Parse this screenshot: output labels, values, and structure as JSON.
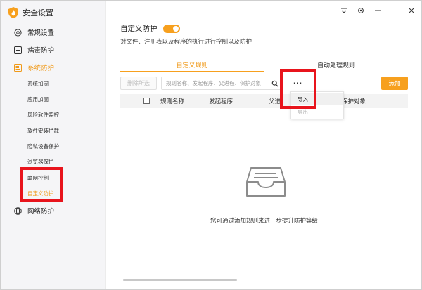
{
  "app": {
    "title": "安全设置",
    "logo_icon": "shield-flame-icon"
  },
  "window_controls": {
    "menu_icon": "menu-icon",
    "settings_icon": "gear-icon",
    "minimize_icon": "minimize-icon",
    "maximize_icon": "maximize-icon",
    "close_icon": "close-icon"
  },
  "sidebar": {
    "groups": [
      {
        "label": "常规设置",
        "icon": "target-icon"
      },
      {
        "label": "病毒防护",
        "icon": "plus-square-icon"
      },
      {
        "label": "系统防护",
        "icon": "system-icon"
      },
      {
        "label": "网络防护",
        "icon": "globe-icon"
      }
    ],
    "sub_items": [
      {
        "label": "系统加固"
      },
      {
        "label": "应用加固"
      },
      {
        "label": "风险软件监控"
      },
      {
        "label": "软件安装拦截"
      },
      {
        "label": "隐私设备保护"
      },
      {
        "label": "浏览器保护"
      },
      {
        "label": "联网控制"
      },
      {
        "label": "自定义防护"
      }
    ]
  },
  "main": {
    "title": "自定义防护",
    "description": "对文件、注册表以及程序的执行进行控制以及防护",
    "toggle_on": true,
    "tabs": [
      {
        "label": "自定义规则"
      },
      {
        "label": "自动处理规则"
      }
    ],
    "toolbar": {
      "delete_label": "删除所选",
      "search_placeholder": "规则名称、发起程序、父进程、保护对象",
      "more_label": "···",
      "add_label": "添加"
    },
    "table_headers": [
      "规则名称",
      "发起程序",
      "父进",
      "保护对象"
    ],
    "dropdown": {
      "import_label": "导入",
      "export_label": "导出"
    },
    "empty_text": "您可通过添加规则来进一步提升防护等级"
  },
  "colors": {
    "accent": "#f7a01e",
    "highlight": "#e8141c"
  }
}
